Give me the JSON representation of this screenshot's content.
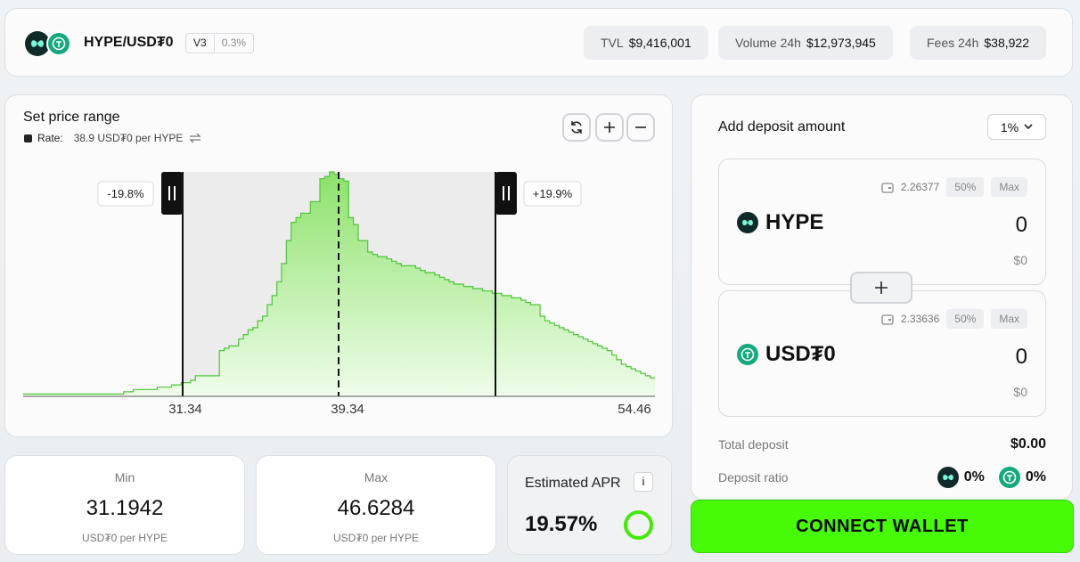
{
  "header": {
    "pair": "HYPE/USD₮0",
    "version": "V3",
    "fee_tier": "0.3%",
    "stats": [
      {
        "label": "TVL",
        "value": "$9,416,001"
      },
      {
        "label": "Volume 24h",
        "value": "$12,973,945"
      },
      {
        "label": "Fees 24h",
        "value": "$38,922"
      }
    ]
  },
  "range": {
    "title": "Set price range",
    "rate_label": "Rate:",
    "rate_value": "38.9 USD₮0 per HYPE",
    "lower_pct": "-19.8%",
    "upper_pct": "+19.9%",
    "ticks": [
      "31.34",
      "39.34",
      "54.46"
    ]
  },
  "min": {
    "label": "Min",
    "value": "31.1942",
    "unit": "USD₮0 per HYPE"
  },
  "max": {
    "label": "Max",
    "value": "46.6284",
    "unit": "USD₮0 per HYPE"
  },
  "apr": {
    "label": "Estimated APR",
    "info": "i",
    "value": "19.57%"
  },
  "deposit": {
    "title": "Add deposit amount",
    "slippage": "1%",
    "tokens": [
      {
        "name": "HYPE",
        "balance": "2.26377",
        "half": "50%",
        "max": "Max",
        "amount": "0",
        "usd": "$0"
      },
      {
        "name": "USD₮0",
        "balance": "2.33636",
        "half": "50%",
        "max": "Max",
        "amount": "0",
        "usd": "$0"
      }
    ],
    "total_label": "Total deposit",
    "total_value": "$0.00",
    "ratio_label": "Deposit ratio",
    "ratio_hype": "0%",
    "ratio_usd": "0%"
  },
  "connect_label": "CONNECT WALLET",
  "colors": {
    "accent": "#47fb07",
    "hype": "#0f2a29",
    "usd": "#16a87e",
    "chart_line": "#4fc43a"
  },
  "chart_data": {
    "type": "area",
    "x_ticks": [
      31.34,
      39.34,
      54.46
    ],
    "current_price": 39.34,
    "range_min": 31.1942,
    "range_max": 46.6284,
    "liquidity_profile": [
      1,
      1,
      1,
      1,
      1,
      1,
      1,
      1,
      1,
      1,
      1,
      1,
      1,
      1,
      1,
      1,
      1,
      1,
      1,
      1,
      1,
      2,
      2,
      3,
      3,
      3,
      3,
      3,
      4,
      4,
      4,
      5,
      5,
      6,
      6,
      7,
      9,
      9,
      9,
      9,
      9,
      20,
      21,
      22,
      22,
      25,
      27,
      29,
      30,
      33,
      35,
      40,
      44,
      50,
      58,
      68,
      76,
      78,
      80,
      80,
      85,
      85,
      95,
      96,
      98,
      97,
      95,
      94,
      78,
      75,
      68,
      68,
      63,
      62,
      61,
      61,
      60,
      59,
      58,
      57,
      57,
      57,
      56,
      55,
      54,
      54,
      53,
      52,
      51,
      50,
      49,
      49,
      48,
      48,
      47,
      47,
      46,
      46,
      45,
      45,
      44,
      44,
      43,
      43,
      42,
      41,
      40,
      40,
      35,
      33,
      32,
      31,
      30,
      29,
      28,
      27,
      26,
      25,
      24,
      23,
      22,
      21,
      20,
      18,
      16,
      14,
      13,
      12,
      11,
      10,
      9,
      8
    ]
  }
}
